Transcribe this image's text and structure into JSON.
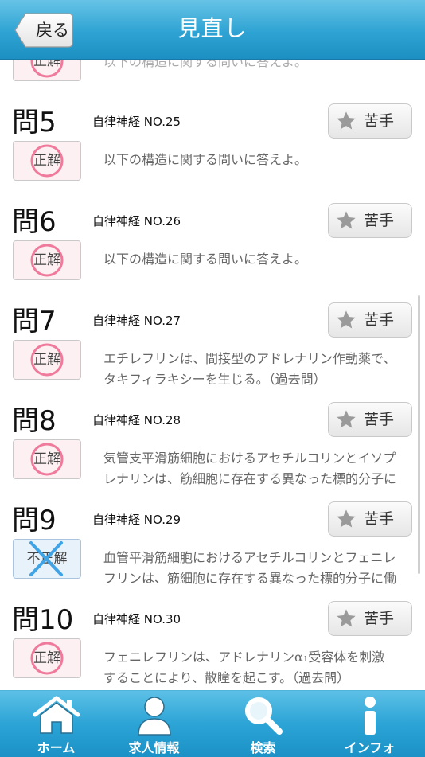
{
  "nav": {
    "back_label": "戻る",
    "title": "見直し"
  },
  "questions": [
    {
      "number": "",
      "category": "",
      "text": "",
      "result": "正解"
    },
    {
      "number": "問5",
      "category": "自律神経 NO.25",
      "text": "以下の構造に関する問いに答えよ。",
      "text2": "",
      "result": "正解",
      "fav_label": "苦手"
    },
    {
      "number": "問6",
      "category": "自律神経 NO.26",
      "text": "以下の構造に関する問いに答えよ。",
      "text2": "",
      "result": "正解",
      "fav_label": "苦手"
    },
    {
      "number": "問7",
      "category": "自律神経 NO.27",
      "text": "エチレフリンは、間接型のアドレナリン作動薬で、",
      "text2": "タキフィラキシーを生じる。（過去問）",
      "result": "正解",
      "fav_label": "苦手"
    },
    {
      "number": "問8",
      "category": "自律神経 NO.28",
      "text": "気管支平滑筋細胞におけるアセチルコリンとイソプ",
      "text2": "レナリンは、筋細胞に存在する異なった標的分子に",
      "result": "正解",
      "fav_label": "苦手"
    },
    {
      "number": "問9",
      "category": "自律神経 NO.29",
      "text": "血管平滑筋細胞におけるアセチルコリンとフェニレ",
      "text2": "フリンは、筋細胞に存在する異なった標的分子に働",
      "result": "不正解",
      "fav_label": "苦手"
    },
    {
      "number": "問10",
      "category": "自律神経 NO.30",
      "text": "フェニレフリンは、アドレナリンα₁受容体を刺激",
      "text2": "することにより、散瞳を起こす。（過去問）",
      "result": "正解",
      "fav_label": "苦手"
    }
  ],
  "tabs": [
    {
      "label": "ホーム",
      "icon": "home-icon"
    },
    {
      "label": "求人情報",
      "icon": "person-icon"
    },
    {
      "label": "検索",
      "icon": "search-icon"
    },
    {
      "label": "インフォ",
      "icon": "info-icon"
    }
  ],
  "colors": {
    "nav_bar": "#2ea3d3",
    "tab_bar": "#2ca4d6",
    "correct_circle": "#f07a9c",
    "incorrect_cross": "#3fa3e6"
  }
}
